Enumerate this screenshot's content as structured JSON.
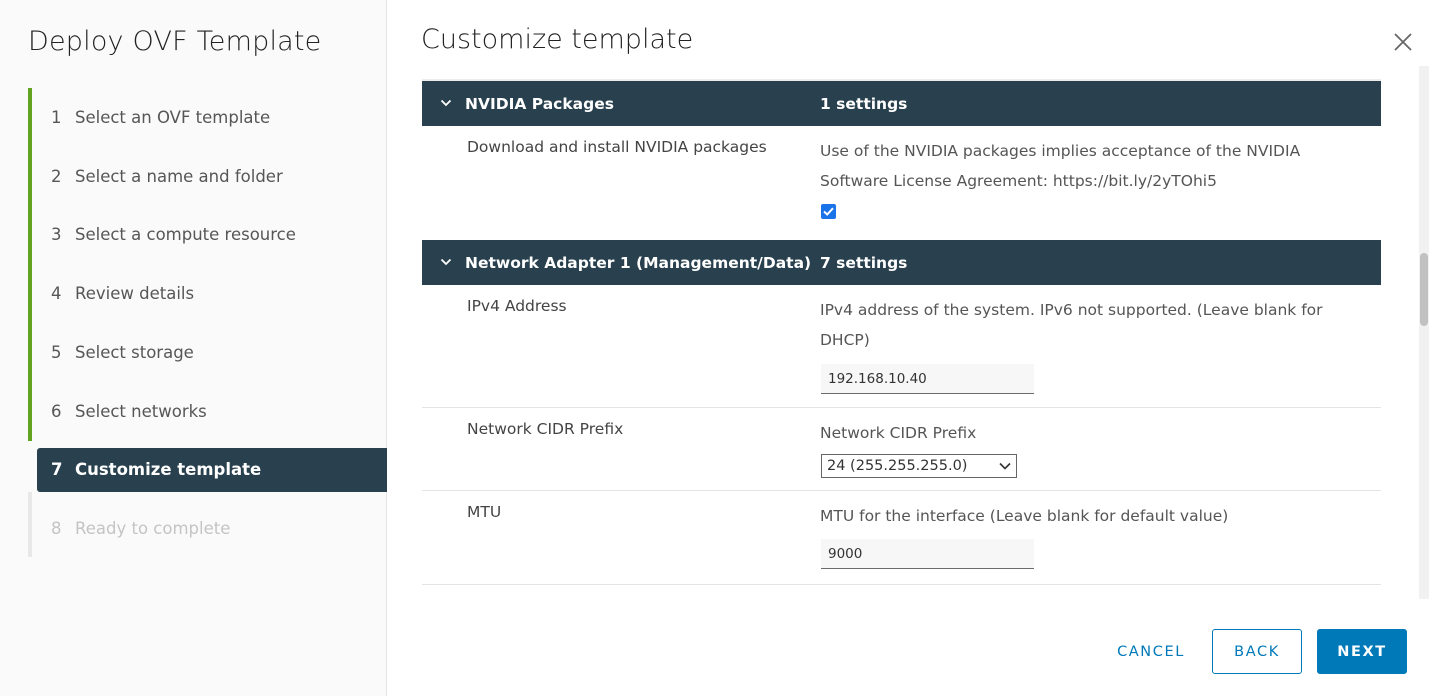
{
  "wizard": {
    "title": "Deploy OVF Template",
    "steps": [
      {
        "num": "1",
        "label": "Select an OVF template"
      },
      {
        "num": "2",
        "label": "Select a name and folder"
      },
      {
        "num": "3",
        "label": "Select a compute resource"
      },
      {
        "num": "4",
        "label": "Review details"
      },
      {
        "num": "5",
        "label": "Select storage"
      },
      {
        "num": "6",
        "label": "Select networks"
      },
      {
        "num": "7",
        "label": "Customize template"
      },
      {
        "num": "8",
        "label": "Ready to complete"
      }
    ],
    "current_step": 7
  },
  "page": {
    "title": "Customize template"
  },
  "sections": [
    {
      "name": "NVIDIA Packages",
      "count": "1 settings",
      "rows": [
        {
          "label": "Download and install NVIDIA packages",
          "description": "Use of the NVIDIA packages implies acceptance of the NVIDIA Software License Agreement: https://bit.ly/2yTOhi5",
          "checked": true
        }
      ]
    },
    {
      "name": "Network Adapter 1 (Management/Data)",
      "count": "7 settings",
      "rows": [
        {
          "label": "IPv4 Address",
          "description": "IPv4 address of the system. IPv6 not supported. (Leave blank for DHCP)",
          "value": "192.168.10.40"
        },
        {
          "label": "Network CIDR Prefix",
          "description": "Network CIDR Prefix",
          "selected": "24 (255.255.255.0)"
        },
        {
          "label": "MTU",
          "description": "MTU for the interface (Leave blank for default value)",
          "value": "9000"
        }
      ]
    }
  ],
  "footer": {
    "cancel_label": "CANCEL",
    "back_label": "BACK",
    "next_label": "NEXT"
  },
  "colors": {
    "accent": "#0079b8",
    "header_bg": "#29414e",
    "done_bar": "#62a420",
    "checkbox": "#1a73e8"
  },
  "icons": {
    "close": "close-icon",
    "chevron": "chevron-down-icon",
    "check": "checkmark-icon"
  }
}
